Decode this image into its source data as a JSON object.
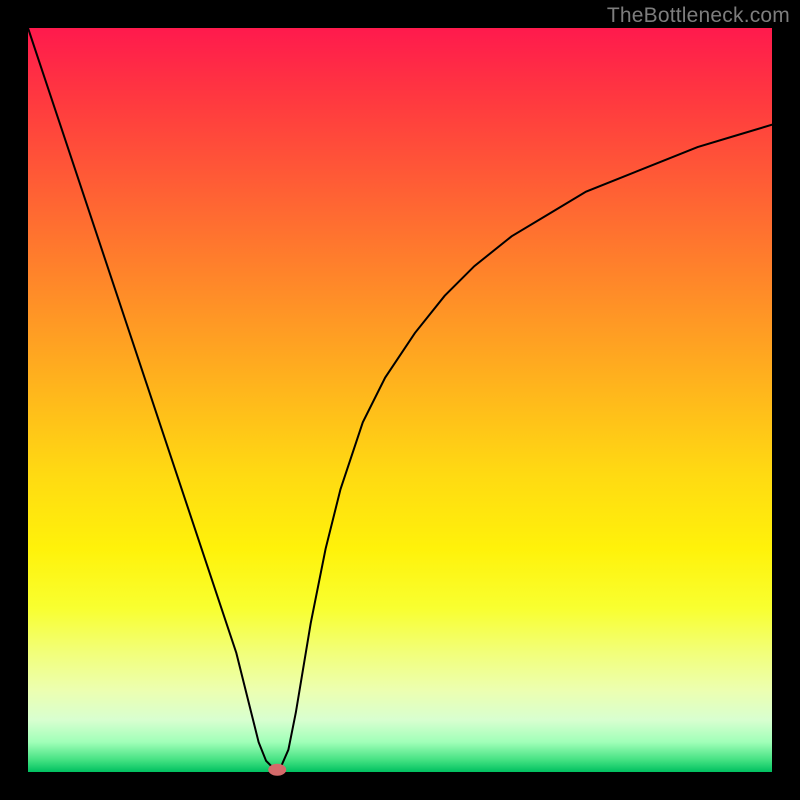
{
  "watermark": {
    "text": "TheBottleneck.com"
  },
  "chart_data": {
    "type": "line",
    "title": "",
    "xlabel": "",
    "ylabel": "",
    "xlim": [
      0,
      100
    ],
    "ylim": [
      0,
      100
    ],
    "x": [
      0,
      2,
      4,
      6,
      8,
      10,
      12,
      14,
      16,
      18,
      20,
      22,
      24,
      26,
      28,
      30,
      31,
      32,
      33,
      33.5,
      34,
      35,
      36,
      37,
      38,
      40,
      42,
      45,
      48,
      52,
      56,
      60,
      65,
      70,
      75,
      80,
      85,
      90,
      95,
      100
    ],
    "values": [
      100,
      94,
      88,
      82,
      76,
      70,
      64,
      58,
      52,
      46,
      40,
      34,
      28,
      22,
      16,
      8,
      4,
      1.5,
      0.5,
      0.3,
      0.7,
      3,
      8,
      14,
      20,
      30,
      38,
      47,
      53,
      59,
      64,
      68,
      72,
      75,
      78,
      80,
      82,
      84,
      85.5,
      87
    ],
    "marker": {
      "x": 33.5,
      "y": 0.3,
      "color": "#d46a6a",
      "rx": 9,
      "ry": 6
    },
    "curve_color": "#000000",
    "curve_width": 2
  },
  "layout": {
    "outer_size": 800,
    "plot_inset": 28,
    "plot_size": 744
  }
}
